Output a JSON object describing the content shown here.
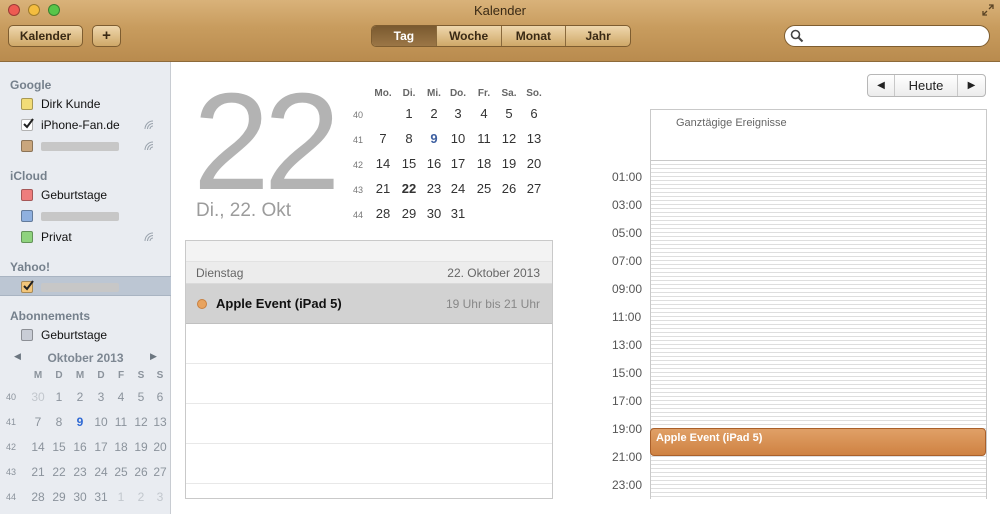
{
  "window": {
    "title": "Kalender",
    "calendars_button": "Kalender",
    "add_button": "+",
    "views": [
      {
        "label": "Tag",
        "active": true
      },
      {
        "label": "Woche",
        "active": false
      },
      {
        "label": "Monat",
        "active": false
      },
      {
        "label": "Jahr",
        "active": false
      }
    ],
    "search": {
      "value": "",
      "placeholder": ""
    }
  },
  "sidebar": {
    "groups": [
      {
        "label": "Google",
        "items": [
          {
            "label": "Dirk Kunde",
            "color": "#f2dc77",
            "checked": false
          },
          {
            "label": "iPhone-Fan.de",
            "color": "#ffffff",
            "checked": true,
            "shared": true
          },
          {
            "label": "",
            "color": "#c9a67d",
            "checked": false,
            "shared": true,
            "redacted": true
          }
        ]
      },
      {
        "label": "iCloud",
        "items": [
          {
            "label": "Geburtstage",
            "color": "#ee7d7d",
            "checked": false
          },
          {
            "label": "",
            "color": "#8fb0df",
            "checked": false,
            "redacted": true
          },
          {
            "label": "Privat",
            "color": "#8fd37e",
            "checked": false,
            "shared": true
          }
        ]
      },
      {
        "label": "Yahoo!",
        "items": [
          {
            "label": "",
            "color": "#f3c67a",
            "checked": true,
            "redacted": true,
            "selected": true
          }
        ]
      },
      {
        "label": "Abonnements",
        "items": [
          {
            "label": "Geburtstage",
            "color": "#c9cdd6",
            "checked": false
          }
        ]
      }
    ],
    "mini_calendar": {
      "title": "Oktober 2013",
      "prev": "◀",
      "next": "▶",
      "weekdays": [
        "M",
        "D",
        "M",
        "D",
        "F",
        "S",
        "S"
      ],
      "weeks": [
        {
          "wk": "40",
          "days": [
            "30",
            "1",
            "2",
            "3",
            "4",
            "5",
            "6"
          ]
        },
        {
          "wk": "41",
          "days": [
            "7",
            "8",
            "9",
            "10",
            "11",
            "12",
            "13"
          ]
        },
        {
          "wk": "42",
          "days": [
            "14",
            "15",
            "16",
            "17",
            "18",
            "19",
            "20"
          ]
        },
        {
          "wk": "43",
          "days": [
            "21",
            "22",
            "23",
            "24",
            "25",
            "26",
            "27"
          ]
        },
        {
          "wk": "44",
          "days": [
            "28",
            "29",
            "30",
            "31",
            "1",
            "2",
            "3"
          ]
        }
      ],
      "today": "9"
    }
  },
  "main": {
    "big_day": "22",
    "date_label": "Di., 22. Okt",
    "month": {
      "weekdays": [
        "Mo.",
        "Di.",
        "Mi.",
        "Do.",
        "Fr.",
        "Sa.",
        "So."
      ],
      "weeks": [
        {
          "wk": "40",
          "days": [
            "",
            "1",
            "2",
            "3",
            "4",
            "5",
            "6"
          ]
        },
        {
          "wk": "41",
          "days": [
            "7",
            "8",
            "9",
            "10",
            "11",
            "12",
            "13"
          ]
        },
        {
          "wk": "42",
          "days": [
            "14",
            "15",
            "16",
            "17",
            "18",
            "19",
            "20"
          ]
        },
        {
          "wk": "43",
          "days": [
            "21",
            "22",
            "23",
            "24",
            "25",
            "26",
            "27"
          ]
        },
        {
          "wk": "44",
          "days": [
            "28",
            "29",
            "30",
            "31",
            "",
            "",
            ""
          ]
        }
      ],
      "today": "9",
      "selected": "22"
    },
    "day_header": {
      "weekday": "Dienstag",
      "date": "22. Oktober 2013"
    },
    "event": {
      "title": "Apple Event (iPad 5)",
      "time": "19 Uhr bis 21 Uhr",
      "color": "#e8a35f"
    }
  },
  "dayview": {
    "nav": {
      "prev": "◀",
      "today": "Heute",
      "next": "▶"
    },
    "allday_label": "Ganztägige Ereignisse",
    "hours": [
      "01:00",
      "03:00",
      "05:00",
      "07:00",
      "09:00",
      "11:00",
      "13:00",
      "15:00",
      "17:00",
      "19:00",
      "21:00",
      "23:00"
    ],
    "event": {
      "title": "Apple Event (iPad 5)"
    }
  }
}
